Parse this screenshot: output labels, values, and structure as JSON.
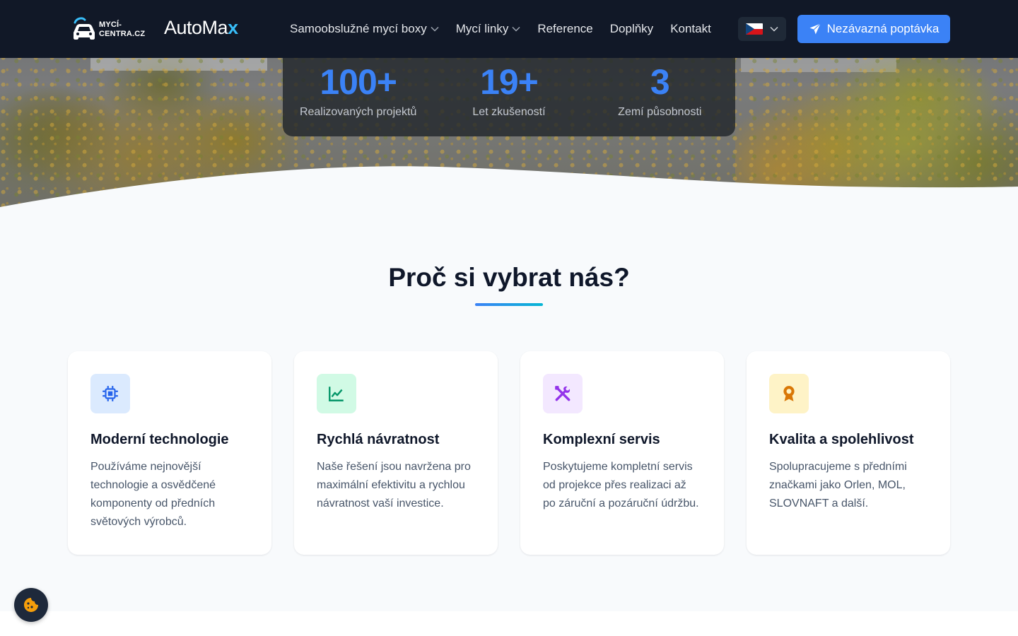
{
  "navbar": {
    "logo_mycentra_line1": "MYCÍ-",
    "logo_mycentra_line2": "CENTRA.CZ",
    "logo_automax": "AutoMa",
    "logo_automax_x": "x",
    "links": [
      {
        "label": "Samoobslužné mycí boxy",
        "dropdown": true
      },
      {
        "label": "Mycí linky",
        "dropdown": true
      },
      {
        "label": "Reference",
        "dropdown": false
      },
      {
        "label": "Doplňky",
        "dropdown": false
      },
      {
        "label": "Kontakt",
        "dropdown": false
      }
    ],
    "language": {
      "flag": "czech-flag",
      "selected": "CZ"
    },
    "cta_label": "Nezávazná poptávka",
    "cta_icon": "paper-plane-icon"
  },
  "stats": [
    {
      "value": "100+",
      "label": "Realizovaných projektů"
    },
    {
      "value": "19+",
      "label": "Let zkušeností"
    },
    {
      "value": "3",
      "label": "Zemí působnosti"
    }
  ],
  "why_us": {
    "title": "Proč si vybrat nás?",
    "cards": [
      {
        "icon": "chip-icon",
        "icon_color": "#2563eb",
        "icon_bg": "#dbeafe",
        "title": "Moderní technologie",
        "text": "Používáme nejnovější technologie a osvědčené komponenty od předních světových výrobců."
      },
      {
        "icon": "chart-line-icon",
        "icon_color": "#059669",
        "icon_bg": "#d1fae5",
        "title": "Rychlá návratnost",
        "text": "Naše řešení jsou navržena pro maximální efektivitu a rychlou návratnost vaší investice."
      },
      {
        "icon": "tools-icon",
        "icon_color": "#9333ea",
        "icon_bg": "#f3e8ff",
        "title": "Komplexní servis",
        "text": "Poskytujeme kompletní servis od projekce přes realizaci až po záruční a pozáruční údržbu."
      },
      {
        "icon": "award-icon",
        "icon_color": "#d97706",
        "icon_bg": "#fef3c7",
        "title": "Kvalita a spolehlivost",
        "text": "Spolupracujeme s předními značkami jako Orlen, MOL, SLOVNAFT a další."
      }
    ]
  },
  "cookie_button": {
    "icon": "cookie-icon"
  },
  "colors": {
    "navbar_bg": "#111827",
    "accent": "#3b82f6",
    "page_bg": "#f8fafc"
  }
}
